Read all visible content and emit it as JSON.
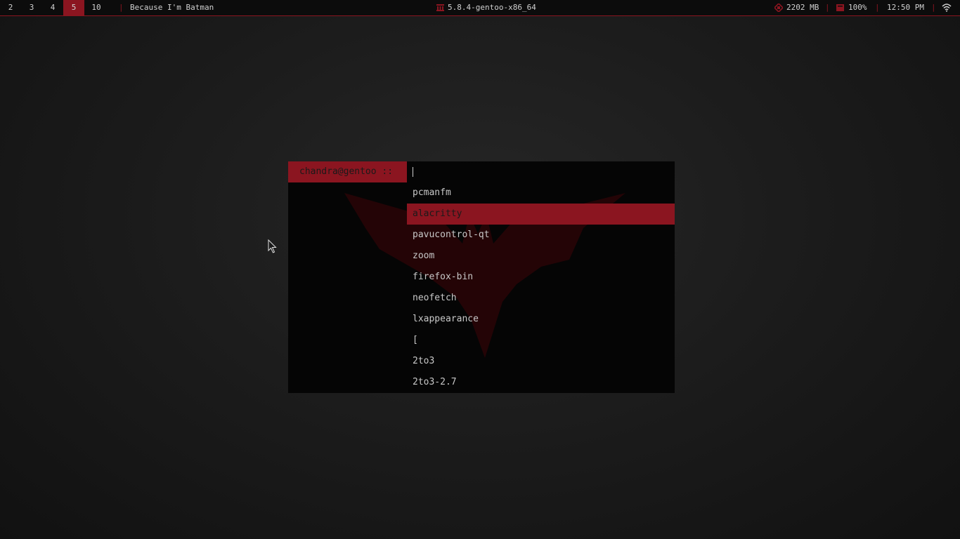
{
  "topbar": {
    "workspaces": [
      {
        "label": "2",
        "active": false
      },
      {
        "label": "3",
        "active": false
      },
      {
        "label": "4",
        "active": false
      },
      {
        "label": "5",
        "active": true
      },
      {
        "label": "10",
        "active": false
      }
    ],
    "window_title": "Because I'm Batman",
    "kernel": "5.8.4-gentoo-x86_64",
    "memory": "2202 MB",
    "battery": "100%",
    "clock": "12:50 PM"
  },
  "launcher": {
    "prompt": "chandra@gentoo ::",
    "query": "",
    "results": [
      "pcmanfm",
      "alacritty",
      "pavucontrol-qt",
      "zoom",
      "firefox-bin",
      "neofetch",
      "lxappearance",
      "[",
      "2to3",
      "2to3-2.7"
    ],
    "selected_index": 1
  },
  "icons": {
    "kernel": "gentoo-icon",
    "memory": "memory-chip-icon",
    "battery": "battery-icon",
    "wifi": "wifi-icon",
    "background": "batman-logo",
    "cursor": "mouse-pointer-icon"
  },
  "colors": {
    "accent": "#8b1520",
    "bar_background": "#0c0c0c",
    "launcher_background": "#050505",
    "text": "#c8c8c8"
  }
}
